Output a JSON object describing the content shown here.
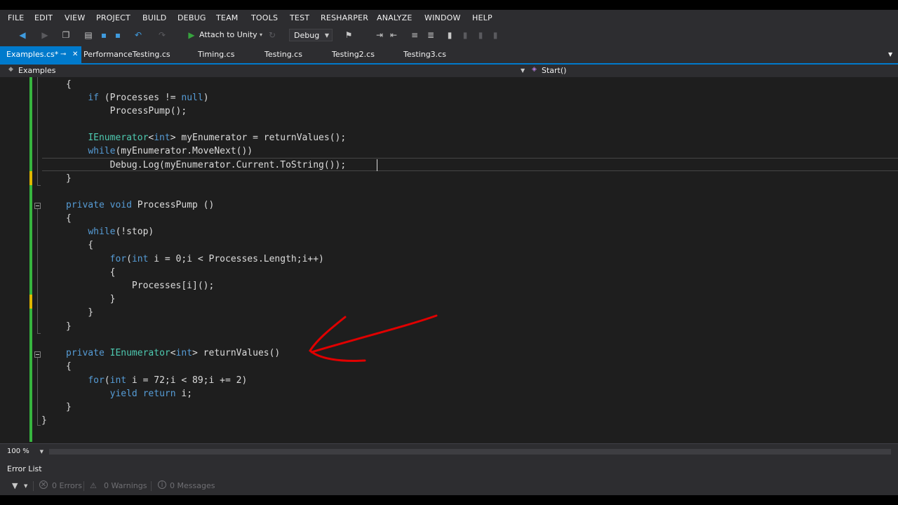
{
  "menu": [
    "FILE",
    "EDIT",
    "VIEW",
    "PROJECT",
    "BUILD",
    "DEBUG",
    "TEAM",
    "TOOLS",
    "TEST",
    "RESHARPER",
    "ANALYZE",
    "WINDOW",
    "HELP"
  ],
  "toolbar": {
    "run_label": "Attach to Unity",
    "config_value": "Debug"
  },
  "tabs": [
    {
      "label": "Examples.cs*",
      "active": true
    },
    {
      "label": "PerformanceTesting.cs"
    },
    {
      "label": "Timing.cs"
    },
    {
      "label": "Testing.cs"
    },
    {
      "label": "Testing2.cs"
    },
    {
      "label": "Testing3.cs"
    }
  ],
  "nav": {
    "type_label": "Examples",
    "member_label": "Start()"
  },
  "code": [
    "{",
    "    if (Processes != null)",
    "        ProcessPump();",
    "",
    "    IEnumerator<int> myEnumerator = returnValues();",
    "    while(myEnumerator.MoveNext())",
    "        Debug.Log(myEnumerator.Current.ToString());",
    "}",
    "",
    "private void ProcessPump ()",
    "{",
    "    while(!stop)",
    "    {",
    "        for(int i = 0;i < Processes.Length;i++)",
    "        {",
    "            Processes[i]();",
    "        }",
    "    }",
    "}",
    "",
    "private IEnumerator<int> returnValues()",
    "{",
    "    for(int i = 72;i < 89;i += 2)",
    "        yield return i;",
    "}",
    "}"
  ],
  "zoom": {
    "value": "100 %"
  },
  "error_list": {
    "title": "Error List",
    "errors": "0 Errors",
    "warnings": "0 Warnings",
    "messages": "0 Messages"
  },
  "colors": {
    "accent": "#007acc",
    "keyword": "#569cd6",
    "type": "#4ec9b0",
    "change_saved": "#37b53f",
    "change_unsaved": "#e0b700",
    "annotation_arrow": "#e00000"
  }
}
